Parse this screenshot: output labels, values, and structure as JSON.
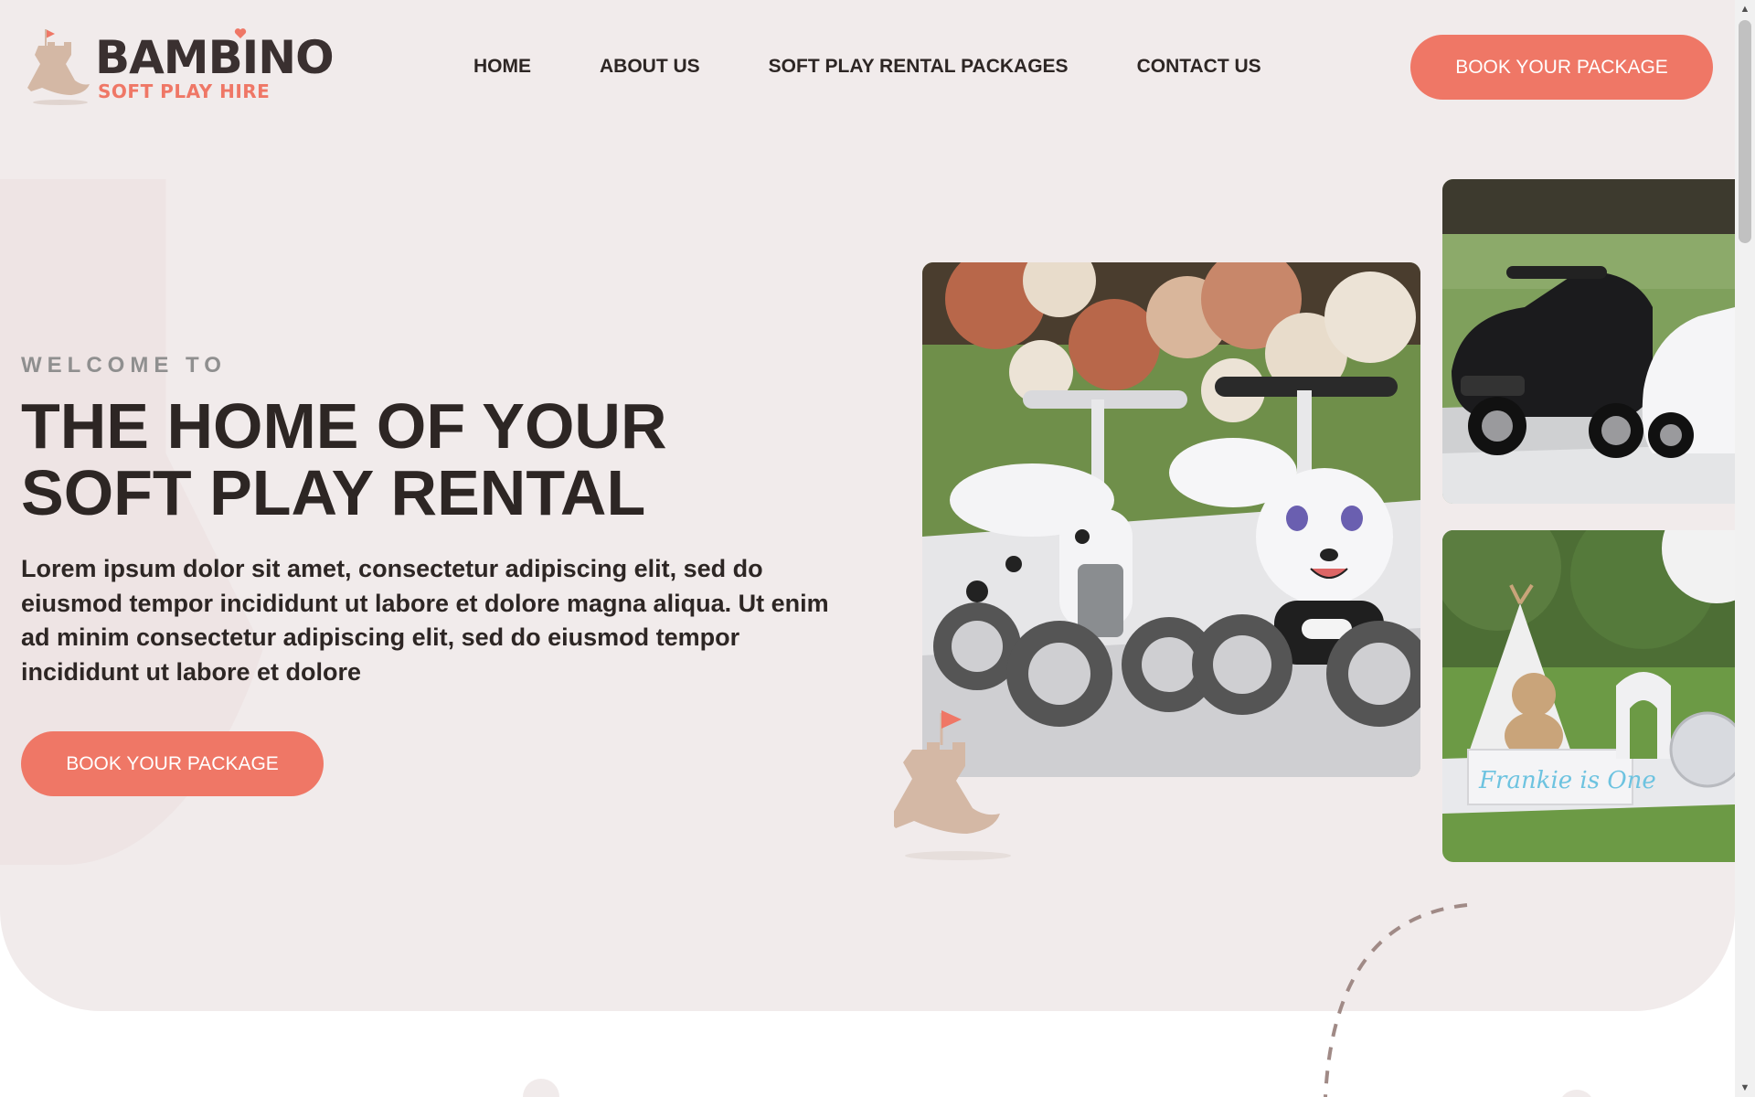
{
  "brand": {
    "name": "BAMBINO",
    "tagline": "SOFT PLAY HIRE",
    "logo_icon": "rocking-horse-castle-icon",
    "heart_icon": "heart-icon",
    "colors": {
      "accent": "#ef7766",
      "dark": "#3a3030",
      "tan": "#d4b8a5",
      "background": "#f1ebeb"
    }
  },
  "nav": {
    "items": [
      {
        "label": "HOME"
      },
      {
        "label": "ABOUT US"
      },
      {
        "label": "SOFT PLAY RENTAL PACKAGES"
      },
      {
        "label": "CONTACT US"
      }
    ],
    "cta_label": "BOOK YOUR PACKAGE"
  },
  "hero": {
    "eyebrow": "WELCOME TO",
    "headline_line1": "THE HOME OF YOUR",
    "headline_line2": "SOFT PLAY RENTAL",
    "body": "Lorem ipsum dolor sit amet, consectetur adipiscing elit, sed do eiusmod tempor incididunt ut labore et dolore magna aliqua. Ut enim ad minim consectetur adipiscing elit, sed do eiusmod tempor incididunt ut labore et dolore",
    "cta_label": "BOOK YOUR PACKAGE"
  },
  "gallery": {
    "tent_sign_text": "Frankie is One"
  }
}
